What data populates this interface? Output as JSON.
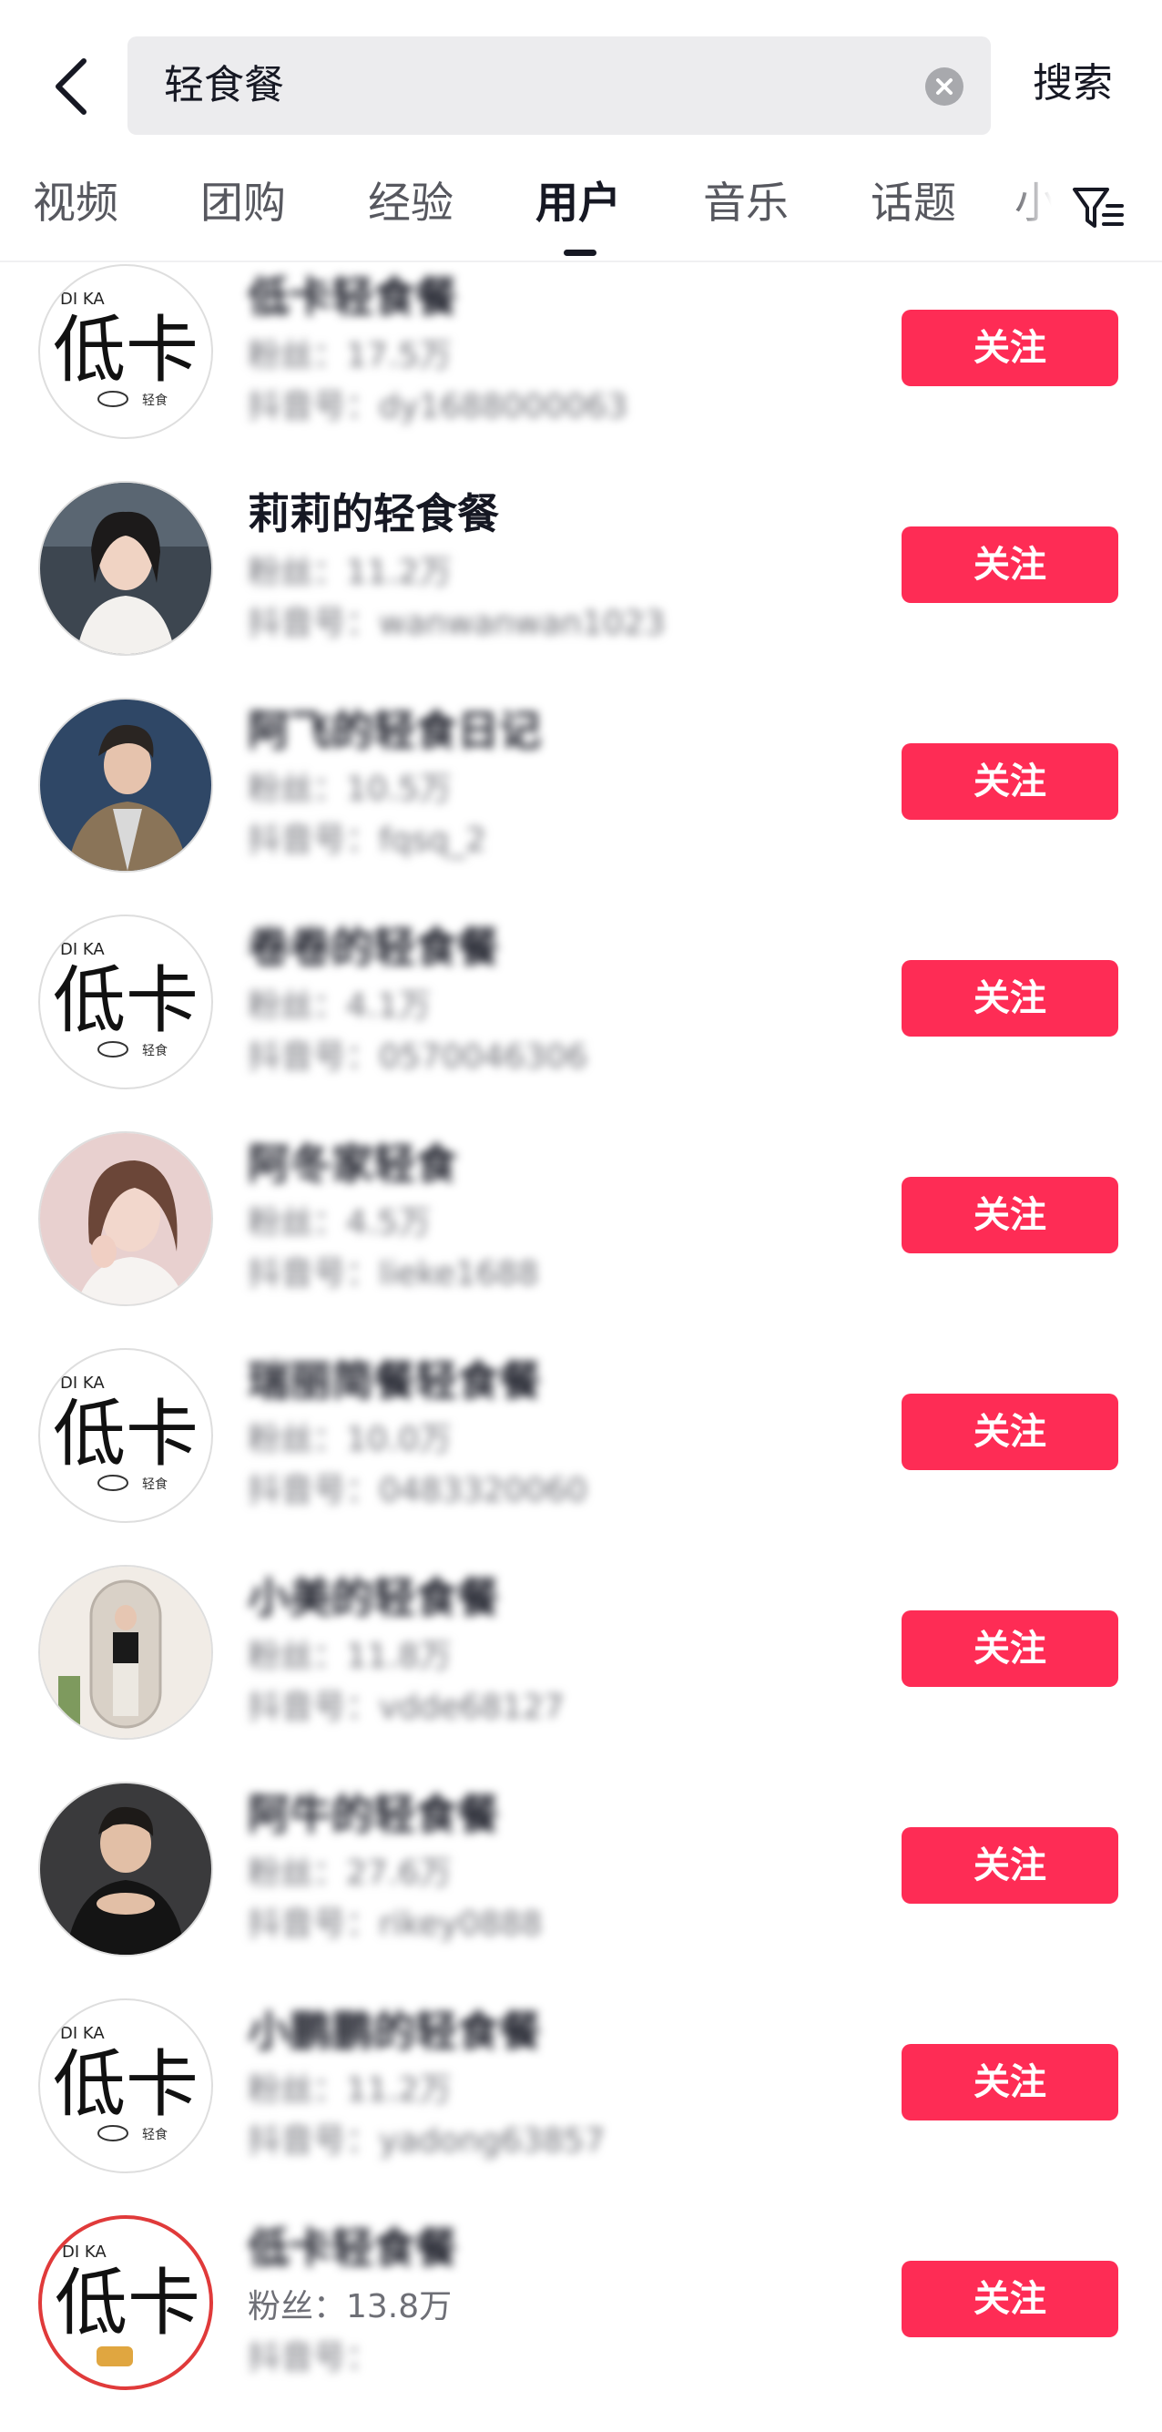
{
  "search": {
    "query": "轻食餐",
    "submit_label": "搜索"
  },
  "tabs": [
    {
      "label": "视频"
    },
    {
      "label": "团购"
    },
    {
      "label": "经验"
    },
    {
      "label": "用户",
      "active": true
    },
    {
      "label": "音乐"
    },
    {
      "label": "话题"
    },
    {
      "label": "小"
    }
  ],
  "colors": {
    "accent": "#fe2c55",
    "text": "#161823",
    "muted": "#6e6f76",
    "search_bg": "#ececee"
  },
  "results": [
    {
      "name": "低卡轻食餐",
      "line2": "粉丝：17.5万",
      "line3": "抖音号：dy1688000063",
      "follow_label": "关注",
      "avatar": "dika-logo-icon"
    },
    {
      "name": "莉莉的轻食餐",
      "line2": "粉丝：11.2万",
      "line3": "抖音号：wanwanwan1023",
      "follow_label": "关注",
      "avatar": "woman-portrait-icon"
    },
    {
      "name": "阿飞的轻食日记",
      "line2": "粉丝：10.5万",
      "line3": "抖音号：fqsq_2",
      "follow_label": "关注",
      "avatar": "man-portrait-icon"
    },
    {
      "name": "卷卷的轻食餐",
      "line2": "粉丝：4.1万",
      "line3": "抖音号：0570046306",
      "follow_label": "关注",
      "avatar": "dika-logo-icon"
    },
    {
      "name": "阿冬家轻食",
      "line2": "粉丝：4.5万",
      "line3": "抖音号：lieke1688",
      "follow_label": "关注",
      "avatar": "woman-portrait-icon"
    },
    {
      "name": "瑞丽简餐轻食餐",
      "line2": "粉丝：10.0万",
      "line3": "抖音号：0483320060",
      "follow_label": "关注",
      "avatar": "dika-logo-icon"
    },
    {
      "name": "小美的轻食餐",
      "line2": "粉丝：11.8万",
      "line3": "抖音号：vdde68127",
      "follow_label": "关注",
      "avatar": "woman-mirror-portrait-icon"
    },
    {
      "name": "阿牛的轻食餐",
      "line2": "粉丝：27.6万",
      "line3": "抖音号：rikey0888",
      "follow_label": "关注",
      "avatar": "man-portrait-icon"
    },
    {
      "name": "小鹏鹏的轻食餐",
      "line2": "粉丝：11.2万",
      "line3": "抖音号：yadong63857",
      "follow_label": "关注",
      "avatar": "dika-logo-icon"
    },
    {
      "name": "低卡轻食餐",
      "line2": "粉丝：13.8万",
      "line3": "抖音号：",
      "follow_label": "关注",
      "avatar": "dika-logo-red-icon"
    }
  ],
  "logo": {
    "brand": "DI KA",
    "mark": "低卡",
    "sub": "轻食"
  }
}
